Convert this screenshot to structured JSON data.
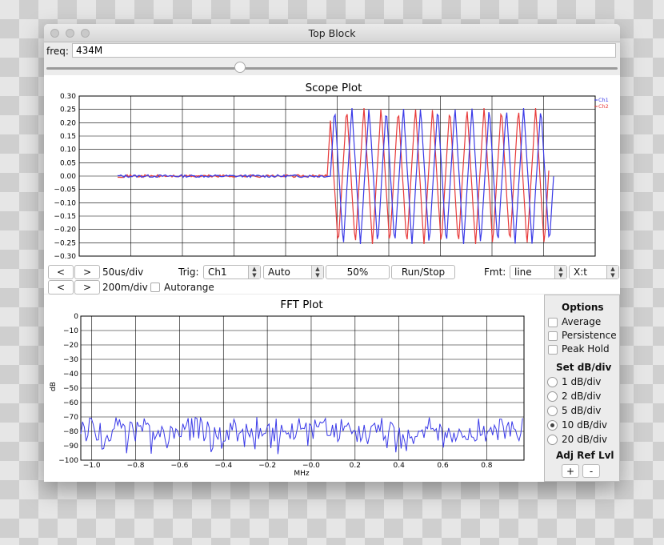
{
  "window": {
    "title": "Top Block"
  },
  "freq": {
    "label": "freq:",
    "value": "434M",
    "slider_fraction": 0.35
  },
  "scope": {
    "title": "Scope Plot",
    "ch1_legend": "Ch1",
    "ch2_legend": "Ch2",
    "y_ticks": [
      "0.30",
      "0.25",
      "0.20",
      "0.15",
      "0.10",
      "0.05",
      "0.00",
      "−0.05",
      "−0.10",
      "−0.15",
      "−0.20",
      "−0.25",
      "−0.30"
    ],
    "controls": {
      "prev": "<",
      "next": ">",
      "time_div": "50us/div",
      "trig_label": "Trig:",
      "trig_channel": "Ch1",
      "trig_mode": "Auto",
      "trig_level": "50%",
      "run_stop": "Run/Stop",
      "fmt_label": "Fmt:",
      "fmt_value": "line",
      "xy_value": "X:t",
      "prev2": "<",
      "next2": ">",
      "volt_div": "200m/div",
      "autorange": "Autorange"
    }
  },
  "fft": {
    "title": "FFT Plot",
    "ylabel": "dB",
    "xlabel": "MHz",
    "y_ticks": [
      "0",
      "−10",
      "−20",
      "−30",
      "−40",
      "−50",
      "−60",
      "−70",
      "−80",
      "−90",
      "−100"
    ],
    "x_ticks": [
      "−1.0",
      "−0.8",
      "−0.6",
      "−0.4",
      "−0.2",
      "−0.0",
      "0.2",
      "0.4",
      "0.6",
      "0.8"
    ]
  },
  "options": {
    "title": "Options",
    "average": "Average",
    "persistence": "Persistence",
    "peak_hold": "Peak Hold",
    "db_div_title": "Set dB/div",
    "db_div_options": [
      "1 dB/div",
      "2 dB/div",
      "5 dB/div",
      "10 dB/div",
      "20 dB/div"
    ],
    "db_div_selected": 3,
    "ref_lvl_title": "Adj Ref Lvl",
    "plus": "+",
    "minus": "-"
  },
  "colors": {
    "ch1": "#3a3ae8",
    "ch2": "#e83a3a",
    "grid": "#000000"
  },
  "chart_data": [
    {
      "type": "line",
      "title": "Scope Plot",
      "ylim": [
        -0.3,
        0.3
      ],
      "grid": true,
      "legend": "top-right",
      "series": [
        {
          "name": "Ch1",
          "description_values": {
            "flat_level": 0.0,
            "oscillation_amplitude": 0.25,
            "cycles_after_trigger": 15
          }
        },
        {
          "name": "Ch2",
          "description_values": {
            "flat_level": 0.0,
            "oscillation_amplitude": 0.25,
            "cycles_after_trigger": 15
          }
        }
      ]
    },
    {
      "type": "line",
      "title": "FFT Plot",
      "xlabel": "MHz",
      "ylabel": "dB",
      "xlim": [
        -1.05,
        0.97
      ],
      "ylim": [
        -100,
        0
      ],
      "grid": true,
      "noise_floor_db": [
        -90,
        -70
      ]
    }
  ]
}
